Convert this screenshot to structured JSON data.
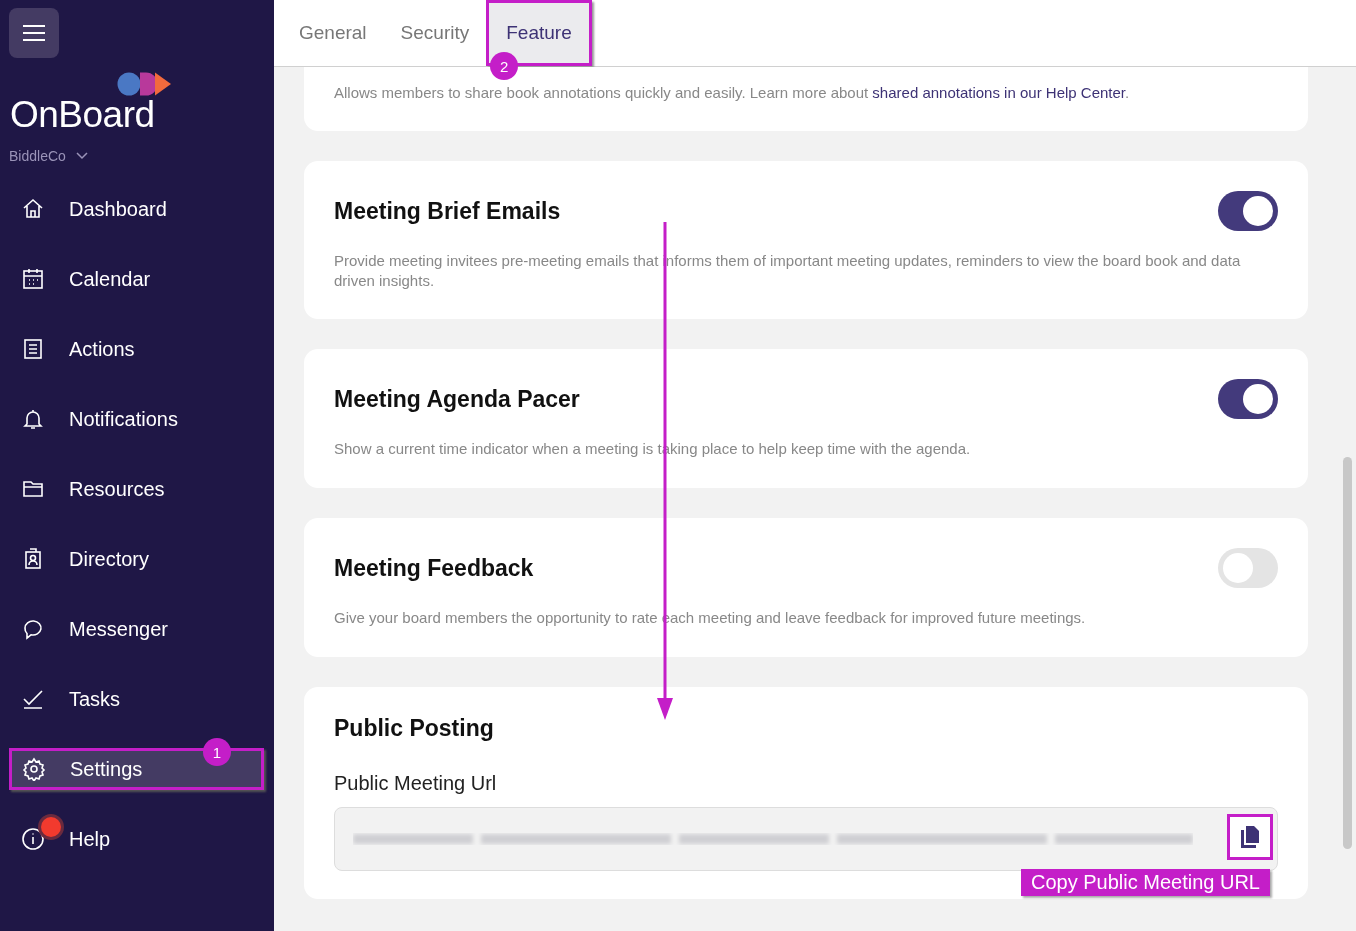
{
  "sidebar": {
    "logo": "OnBoard",
    "organization": "BiddleCo",
    "items": [
      {
        "label": "Dashboard",
        "selected": false,
        "alert": false
      },
      {
        "label": "Calendar",
        "selected": false,
        "alert": false
      },
      {
        "label": "Actions",
        "selected": false,
        "alert": false
      },
      {
        "label": "Notifications",
        "selected": false,
        "alert": false
      },
      {
        "label": "Resources",
        "selected": false,
        "alert": false
      },
      {
        "label": "Directory",
        "selected": false,
        "alert": false
      },
      {
        "label": "Messenger",
        "selected": false,
        "alert": false
      },
      {
        "label": "Tasks",
        "selected": false,
        "alert": false
      },
      {
        "label": "Settings",
        "selected": true,
        "alert": false,
        "callout": "1"
      },
      {
        "label": "Help",
        "selected": false,
        "alert": true
      }
    ]
  },
  "tabs": [
    {
      "label": "General",
      "selected": false
    },
    {
      "label": "Security",
      "selected": false
    },
    {
      "label": "Feature",
      "selected": true,
      "callout": "2"
    }
  ],
  "cards": [
    {
      "kind": "partial",
      "description": "Allows members to share book annotations quickly and easily. Learn more about ",
      "link": "shared annotations in our Help Center",
      "suffix": "."
    },
    {
      "kind": "toggle",
      "title": "Meeting Brief Emails",
      "description": "Provide meeting invitees pre-meeting emails that informs them of important meeting updates, reminders to view the board book and data driven insights.",
      "on": true
    },
    {
      "kind": "toggle",
      "title": "Meeting Agenda Pacer",
      "description": "Show a current time indicator when a meeting is taking place to help keep time with the agenda.",
      "on": true
    },
    {
      "kind": "toggle",
      "title": "Meeting Feedback",
      "description": "Give your board members the opportunity to rate each meeting and leave feedback for improved future meetings.",
      "on": false
    },
    {
      "kind": "url",
      "title": "Public Posting",
      "field_label": "Public Meeting Url",
      "callout": "Copy Public Meeting URL"
    }
  ]
}
